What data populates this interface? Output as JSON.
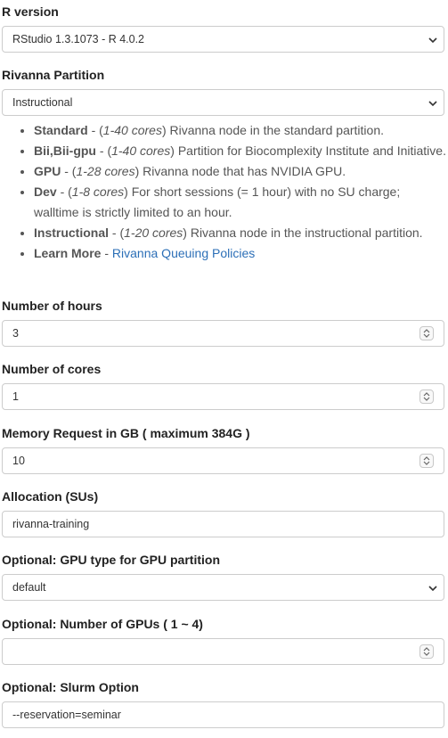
{
  "r_version": {
    "label": "R version",
    "selected": "RStudio 1.3.1073 - R 4.0.2"
  },
  "partition": {
    "label": "Rivanna Partition",
    "selected": "Instructional",
    "items": [
      {
        "name": "Standard",
        "sep": " - (",
        "cores": "1-40 cores",
        "desc": ") Rivanna node in the standard partition."
      },
      {
        "name": "Bii,Bii-gpu",
        "sep": " - (",
        "cores": "1-40 cores",
        "desc": ") Partition for Biocomplexity Institute and Initiative."
      },
      {
        "name": "GPU",
        "sep": " - (",
        "cores": "1-28 cores",
        "desc": ") Rivanna node that has NVIDIA GPU."
      },
      {
        "name": "Dev",
        "sep": " - (",
        "cores": "1-8 cores",
        "desc": ") For short sessions (= 1 hour) with no SU charge; walltime is strictly limited to an hour."
      },
      {
        "name": "Instructional",
        "sep": " - (",
        "cores": "1-20 cores",
        "desc": ") Rivanna node in the instructional partition."
      }
    ],
    "learn_more": {
      "label": "Learn More",
      "sep": " - ",
      "link": "Rivanna Queuing Policies"
    }
  },
  "hours": {
    "label": "Number of hours",
    "value": "3"
  },
  "cores": {
    "label": "Number of cores",
    "value": "1"
  },
  "memory": {
    "label": "Memory Request in GB ( maximum 384G )",
    "value": "10"
  },
  "allocation": {
    "label": "Allocation (SUs)",
    "value": "rivanna-training"
  },
  "gpu_type": {
    "label": "Optional: GPU type for GPU partition",
    "selected": "default"
  },
  "num_gpus": {
    "label": "Optional: Number of GPUs ( 1 ~ 4)",
    "value": ""
  },
  "slurm": {
    "label": "Optional: Slurm Option",
    "value": "--reservation=seminar"
  }
}
